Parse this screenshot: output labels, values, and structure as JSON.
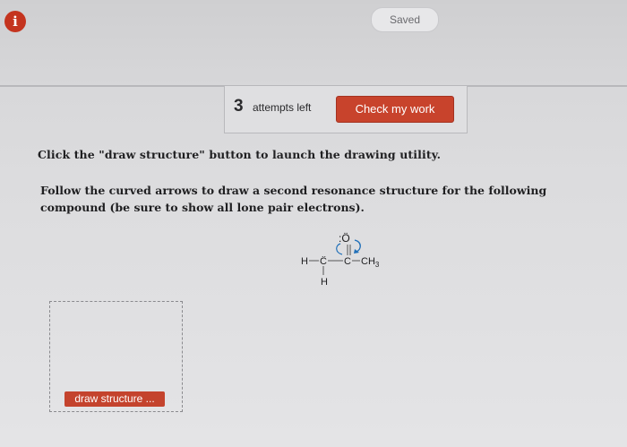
{
  "header": {
    "info_icon": "i",
    "saved_label": "Saved"
  },
  "attempts": {
    "count": "3",
    "label": "attempts left",
    "check_button": "Check my work"
  },
  "instructions": {
    "line1": "Click the \"draw structure\" button to launch the drawing utility.",
    "line2": "Follow the curved arrows to draw a second resonance structure for the following compound (be sure to show all lone pair electrons)."
  },
  "molecule": {
    "oxygen": ":Ö",
    "left_h": "H",
    "carbon1": "C",
    "carbon2": "C",
    "methyl": "CH",
    "methyl_sub": "3",
    "bottom_h": "H",
    "bond": "—"
  },
  "draw_area": {
    "button_label": "draw structure ..."
  },
  "colors": {
    "accent": "#c8432c",
    "arrow": "#1f6fb8"
  }
}
